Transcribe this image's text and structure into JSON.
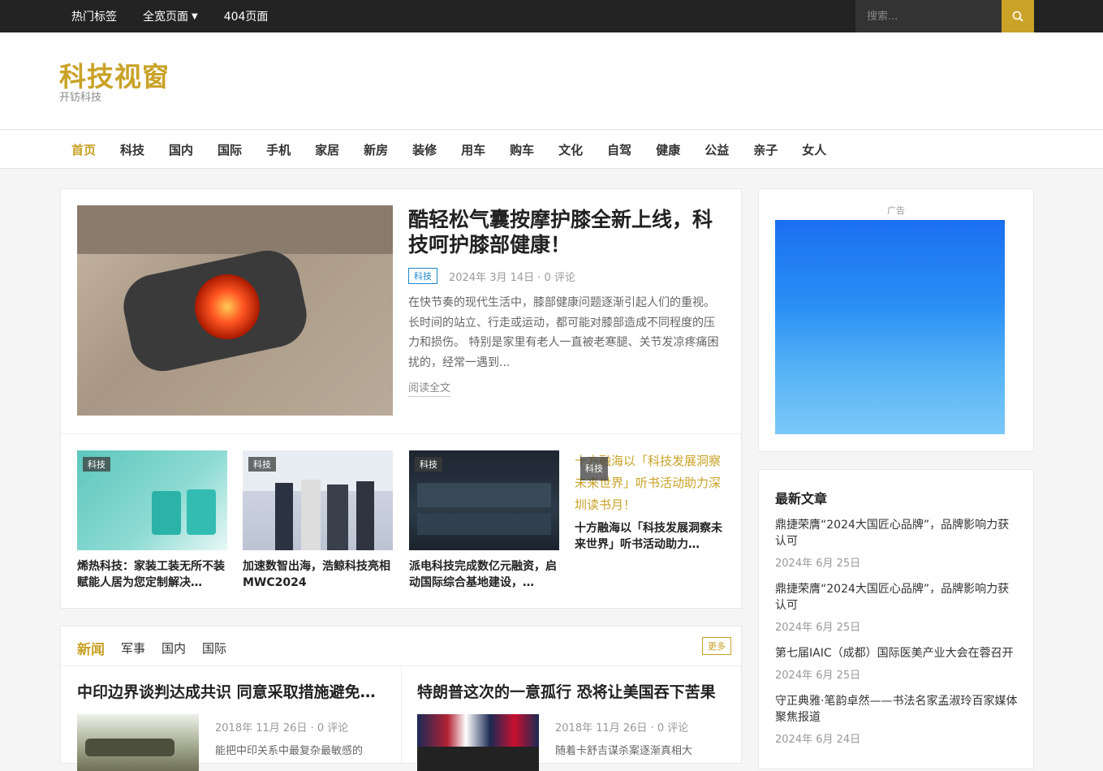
{
  "topbar": {
    "links": [
      "热门标签",
      "全宽页面",
      "404页面"
    ],
    "search_placeholder": "搜索..."
  },
  "site": {
    "title": "科技视窗",
    "tagline": "开钫科技"
  },
  "nav": [
    "首页",
    "科技",
    "国内",
    "国际",
    "手机",
    "家居",
    "新房",
    "装修",
    "用车",
    "购车",
    "文化",
    "自驾",
    "健康",
    "公益",
    "亲子",
    "女人"
  ],
  "featured": {
    "title": "酷轻松气囊按摩护膝全新上线，科技呵护膝部健康！",
    "category": "科技",
    "meta": "2024年 3月 14日 · 0 评论",
    "excerpt": "在快节奏的现代生活中，膝部健康问题逐渐引起人们的重视。长时间的站立、行走或运动，都可能对膝部造成不同程度的压力和损伤。 特别是家里有老人一直被老寒腿、关节发凉疼痛困扰的，经常一遇到...",
    "read_more": "阅读全文"
  },
  "small_posts": [
    {
      "tag": "科技",
      "title": "烯热科技：家装工装无所不装赋能人居为您定制解决…"
    },
    {
      "tag": "科技",
      "title": "加速数智出海，浩鲸科技亮相MWC2024"
    },
    {
      "tag": "科技",
      "title": "派电科技完成数亿元融资，启动国际综合基地建设，…"
    },
    {
      "tag": "科技",
      "alt": "十方融海以「科技发展洞察未来世界」听书活动助力深圳读书月！",
      "title": "十方融海以「科技发展洞察未来世界」听书活动助力…"
    }
  ],
  "news": {
    "tabs": [
      "新闻",
      "军事",
      "国内",
      "国际"
    ],
    "more": "更多",
    "items": [
      {
        "title": "中印边界谈判达成共识 同意采取措施避免…",
        "meta": "2018年 11月 26日 · 0 评论",
        "excerpt": "能把中印关系中最复杂最敏感的"
      },
      {
        "title": "特朗普这次的一意孤行 恐将让美国吞下苦果",
        "meta": "2018年 11月 26日 · 0 评论",
        "excerpt": "随着卡舒吉谋杀案逐渐真相大"
      }
    ]
  },
  "sidebar": {
    "ad_label": "广告",
    "recent_title": "最新文章",
    "recent": [
      {
        "title": "鼎捷荣膺“2024大国匠心品牌”，品牌影响力获认可",
        "date": "2024年 6月 25日"
      },
      {
        "title": "鼎捷荣膺“2024大国匠心品牌”，品牌影响力获认可",
        "date": "2024年 6月 25日"
      },
      {
        "title": "第七届IAIC（成都）国际医美产业大会在蓉召开",
        "date": "2024年 6月 25日"
      },
      {
        "title": "守正典雅·笔韵卓然——书法名家孟淑玲百家媒体聚焦报道",
        "date": "2024年 6月 24日"
      }
    ]
  },
  "colors": {
    "accent": "#c9a227",
    "topbar": "#232323",
    "badge": "#1e8acb"
  }
}
